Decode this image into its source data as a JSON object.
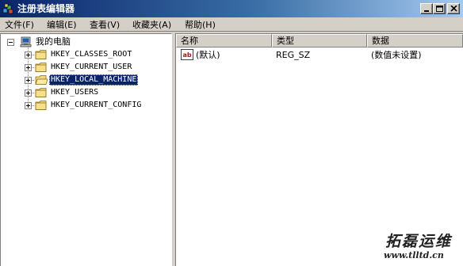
{
  "window": {
    "title": "注册表编辑器",
    "icon": "registry-editor-icon",
    "controls": {
      "minimize": "minimize-icon",
      "maximize": "maximize-icon",
      "close": "close-icon"
    }
  },
  "menu": {
    "items": [
      {
        "label": "文件(F)"
      },
      {
        "label": "编辑(E)"
      },
      {
        "label": "查看(V)"
      },
      {
        "label": "收藏夹(A)"
      },
      {
        "label": "帮助(H)"
      }
    ]
  },
  "tree": {
    "root": {
      "label": "我的电脑",
      "icon": "computer-icon",
      "expander": "minus"
    },
    "keys": [
      {
        "label": "HKEY_CLASSES_ROOT",
        "expander": "plus",
        "selected": false
      },
      {
        "label": "HKEY_CURRENT_USER",
        "expander": "plus",
        "selected": false
      },
      {
        "label": "HKEY_LOCAL_MACHINE",
        "expander": "plus",
        "selected": true
      },
      {
        "label": "HKEY_USERS",
        "expander": "plus",
        "selected": false
      },
      {
        "label": "HKEY_CURRENT_CONFIG",
        "expander": "plus",
        "selected": false
      }
    ]
  },
  "list": {
    "columns": [
      {
        "label": "名称"
      },
      {
        "label": "类型"
      },
      {
        "label": "数据"
      }
    ],
    "rows": [
      {
        "icon": "string-value-icon",
        "name": "(默认)",
        "type": "REG_SZ",
        "data": "(数值未设置)"
      }
    ]
  },
  "watermark": {
    "logo": "拓磊运维",
    "url": "www.tlltd.cn"
  },
  "colors": {
    "titlebar_start": "#0a246a",
    "titlebar_end": "#a6caf0",
    "selection": "#0a246a",
    "face": "#d4d0c8",
    "folder": "#f2d675"
  }
}
